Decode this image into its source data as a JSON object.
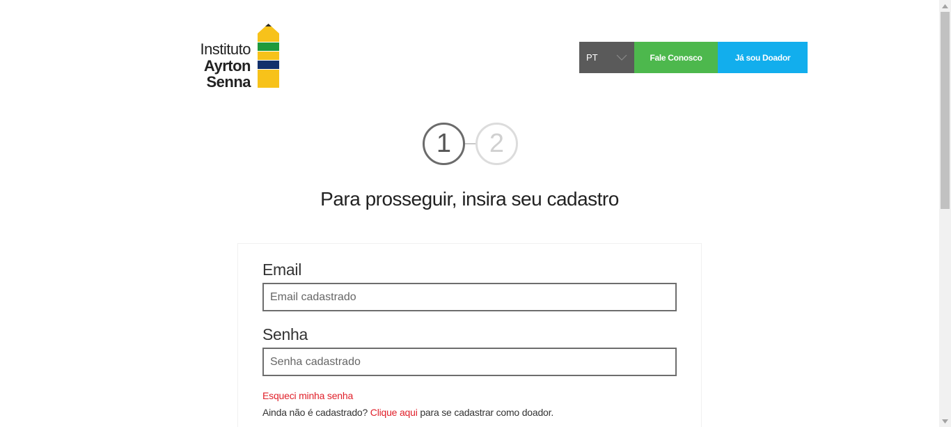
{
  "logo": {
    "line1": "Instituto",
    "line2": "Ayrton",
    "line3": "Senna",
    "colors": {
      "yellow": "#f7c21a",
      "green": "#1f9a3c",
      "navy": "#12306b"
    }
  },
  "header": {
    "language": {
      "selected": "PT",
      "icon": "chevron-down-icon"
    },
    "contact_label": "Fale Conosco",
    "donor_label": "Já sou Doador",
    "colors": {
      "language_bg": "#5a5a5a",
      "contact_bg": "#4db84d",
      "donor_bg": "#12aeed"
    }
  },
  "steps": {
    "items": [
      {
        "number": "1",
        "state": "active"
      },
      {
        "number": "2",
        "state": "inactive"
      }
    ]
  },
  "main": {
    "heading": "Para prosseguir, insira seu cadastro"
  },
  "form": {
    "email_label": "Email",
    "email_placeholder": "Email cadastrado",
    "email_value": "",
    "password_label": "Senha",
    "password_placeholder": "Senha cadastrado",
    "password_value": "",
    "forgot_password": "Esqueci minha senha",
    "register_prefix": "Ainda não é cadastrado?",
    "register_link": "Clique aqui",
    "register_suffix": "para se cadastrar como doador.",
    "link_color": "#e0202a"
  }
}
